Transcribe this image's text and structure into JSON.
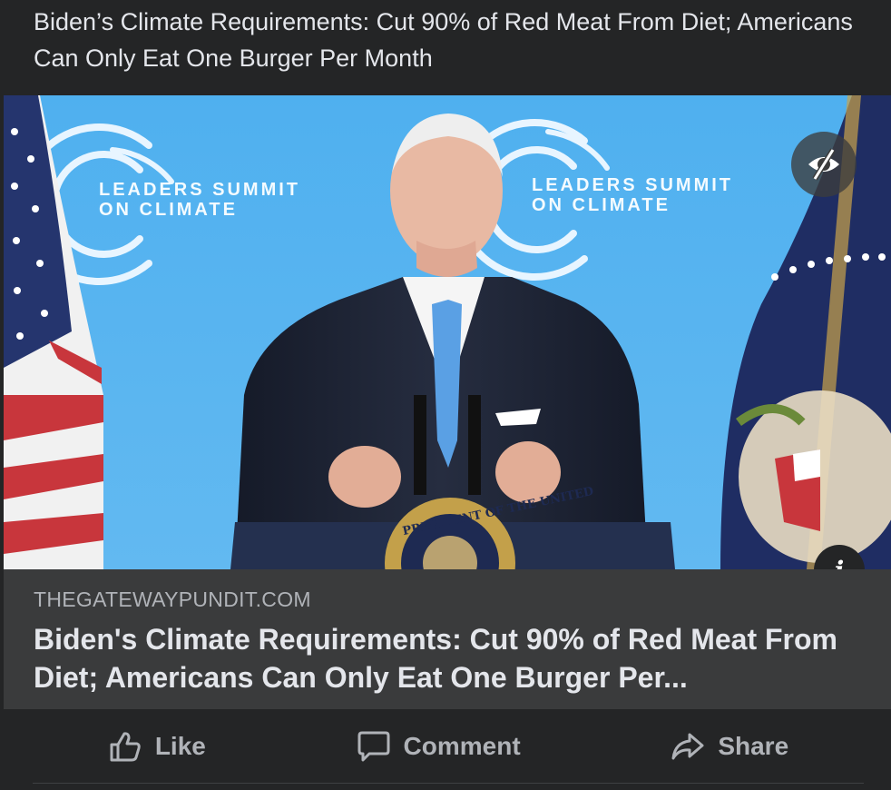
{
  "post": {
    "text": "Biden’s Climate Requirements: Cut 90% of Red Meat From Diet; Americans Can Only Eat One Burger Per Month"
  },
  "link_card": {
    "image": {
      "backdrop_text_left": "LEADERS SUMMIT",
      "backdrop_text_left_2": "ON CLIMATE",
      "backdrop_text_right": "LEADERS SUMMIT",
      "backdrop_text_right_2": "ON CLIMATE",
      "seal_text": "PRESIDENT OF THE UNITED"
    },
    "info_icon": "i",
    "domain": "THEGATEWAYPUNDIT.COM",
    "headline": "Biden's Climate Requirements: Cut 90% of Red Meat From Diet; Americans Can Only Eat One Burger Per..."
  },
  "actions": {
    "like_label": "Like",
    "comment_label": "Comment",
    "share_label": "Share"
  },
  "colors": {
    "background": "#242526",
    "card": "#3a3b3c",
    "secondary_text": "#b0b3b8",
    "primary_text": "#e4e6eb"
  }
}
